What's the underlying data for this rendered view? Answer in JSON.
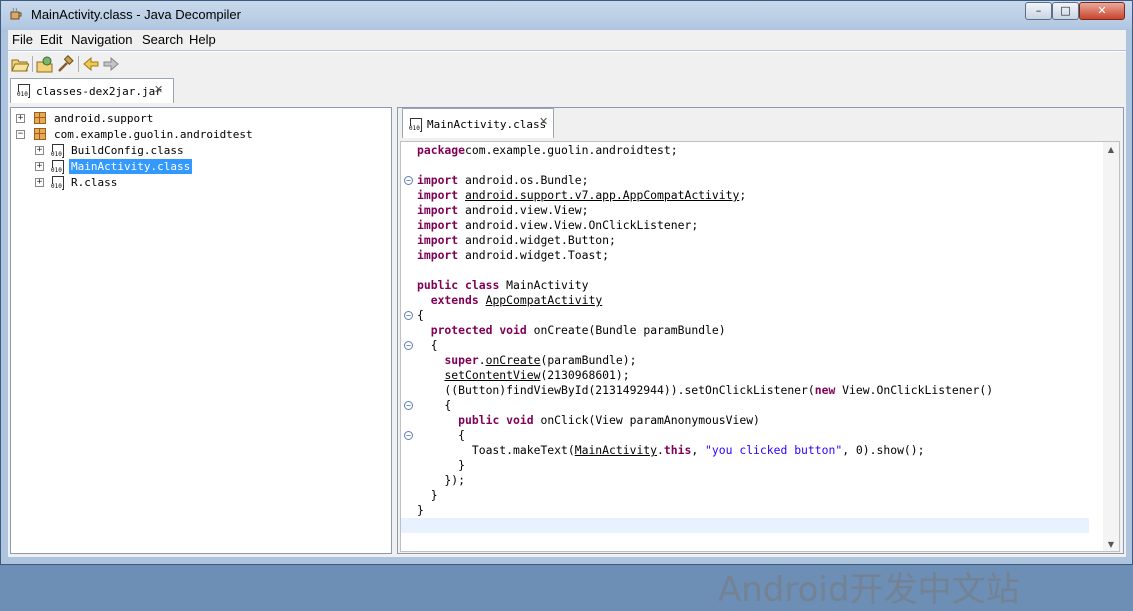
{
  "window": {
    "title": "MainActivity.class - Java Decompiler",
    "minimize": "–",
    "maximize": "□",
    "close": "✕"
  },
  "menu": [
    "File",
    "Edit",
    "Navigation",
    "Search",
    "Help"
  ],
  "toolbar_icons": [
    "open-file-icon",
    "open-type-icon",
    "hammer-icon",
    "back-arrow-icon",
    "forward-arrow-icon"
  ],
  "top_tab": {
    "label": "classes-dex2jar.jar",
    "close": "✕"
  },
  "tree": [
    {
      "label": "android.support",
      "expander": "+",
      "type": "package"
    },
    {
      "label": "com.example.guolin.androidtest",
      "expander": "−",
      "type": "package"
    },
    {
      "label": "BuildConfig.class",
      "expander": "+",
      "type": "class"
    },
    {
      "label": "MainActivity.class",
      "expander": "+",
      "type": "class",
      "selected": true
    },
    {
      "label": "R.class",
      "expander": "+",
      "type": "class"
    }
  ],
  "editor_tab": {
    "label": "MainActivity.class",
    "close": "✕"
  },
  "file_icon_text": "010",
  "code_lines": [
    [
      [
        "kw",
        "package"
      ],
      [
        "",
        "com.example.guolin.androidtest;"
      ]
    ],
    [],
    [
      [
        "kw",
        "import"
      ],
      [
        "",
        " android.os.Bundle;"
      ]
    ],
    [
      [
        "kw",
        "import"
      ],
      [
        "",
        " "
      ],
      [
        "ul",
        "android.support.v7.app.AppCompatActivity"
      ],
      [
        "",
        ";"
      ]
    ],
    [
      [
        "kw",
        "import"
      ],
      [
        "",
        " android.view.View;"
      ]
    ],
    [
      [
        "kw",
        "import"
      ],
      [
        "",
        " android.view.View.OnClickListener;"
      ]
    ],
    [
      [
        "kw",
        "import"
      ],
      [
        "",
        " android.widget.Button;"
      ]
    ],
    [
      [
        "kw",
        "import"
      ],
      [
        "",
        " android.widget.Toast;"
      ]
    ],
    [],
    [
      [
        "kw",
        "public"
      ],
      [
        "",
        " "
      ],
      [
        "kw",
        "class"
      ],
      [
        "",
        " MainActivity"
      ]
    ],
    [
      [
        "",
        "  "
      ],
      [
        "kw",
        "extends"
      ],
      [
        "",
        " "
      ],
      [
        "ul",
        "AppCompatActivity"
      ]
    ],
    [
      [
        "",
        "{"
      ]
    ],
    [
      [
        "",
        "  "
      ],
      [
        "kw",
        "protected"
      ],
      [
        "",
        " "
      ],
      [
        "kw",
        "void"
      ],
      [
        "",
        " onCreate(Bundle paramBundle)"
      ]
    ],
    [
      [
        "",
        "  {"
      ]
    ],
    [
      [
        "",
        "    "
      ],
      [
        "kw",
        "super"
      ],
      [
        "",
        "."
      ],
      [
        "ul",
        "onCreate"
      ],
      [
        "",
        "(paramBundle);"
      ]
    ],
    [
      [
        "",
        "    "
      ],
      [
        "ul",
        "setContentView"
      ],
      [
        "",
        "(2130968601);"
      ]
    ],
    [
      [
        "",
        "    ((Button)findViewById(2131492944)).setOnClickListener("
      ],
      [
        "kw",
        "new"
      ],
      [
        "",
        " View.OnClickListener()"
      ]
    ],
    [
      [
        "",
        "    {"
      ]
    ],
    [
      [
        "",
        "      "
      ],
      [
        "kw",
        "public"
      ],
      [
        "",
        " "
      ],
      [
        "kw",
        "void"
      ],
      [
        "",
        " onClick(View paramAnonymousView)"
      ]
    ],
    [
      [
        "",
        "      {"
      ]
    ],
    [
      [
        "",
        "        Toast.makeText("
      ],
      [
        "ul",
        "MainActivity"
      ],
      [
        "",
        "."
      ],
      [
        "kw",
        "this"
      ],
      [
        "",
        ", "
      ],
      [
        "str",
        "\"you clicked button\""
      ],
      [
        "",
        ", 0).show();"
      ]
    ],
    [
      [
        "",
        "      }"
      ]
    ],
    [
      [
        "",
        "    });"
      ]
    ],
    [
      [
        "",
        "  }"
      ]
    ],
    [
      [
        "",
        "}"
      ]
    ]
  ],
  "fold_markers": [
    2,
    11,
    13,
    17,
    19
  ],
  "fold_glyph": "−",
  "scroll": {
    "up": "▲",
    "down": "▼"
  },
  "watermark": "Android开发中文站"
}
